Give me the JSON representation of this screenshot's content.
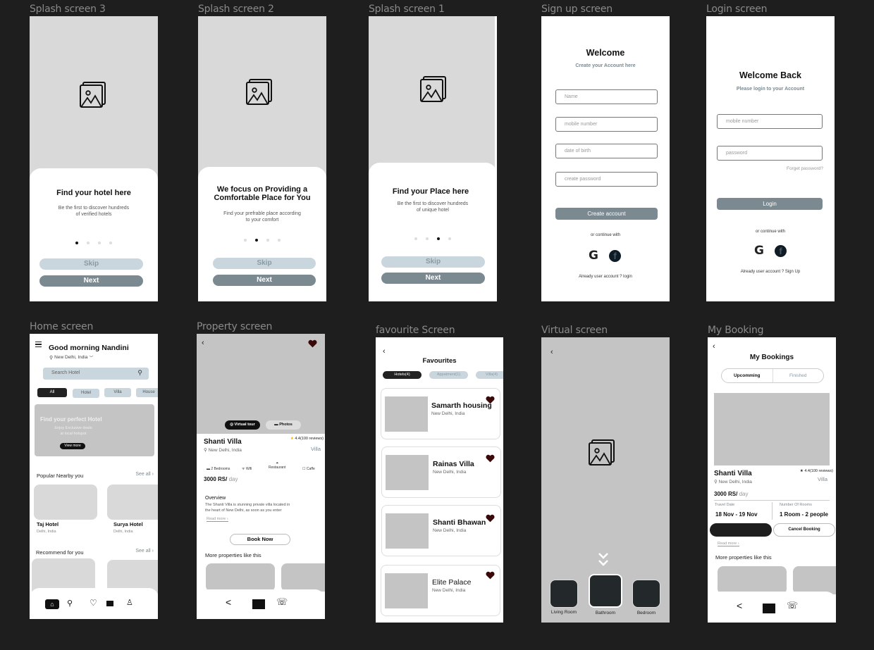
{
  "frames": {
    "splash3": {
      "label": "Splash screen 3",
      "title": "Find your hotel here",
      "subtitle_line1": "Be the first to discover hundreds",
      "subtitle_line2": "of verified hotels",
      "active_dot": 0,
      "skip": "Skip",
      "next": "Next"
    },
    "splash2": {
      "label": "Splash screen 2",
      "title_line1": "We focus on Providing a",
      "title_line2": "Comfortable Place for You",
      "subtitle_line1": "Find your prefrable place  according",
      "subtitle_line2": "to your comfort",
      "active_dot": 1,
      "skip": "Skip",
      "next": "Next"
    },
    "splash1": {
      "label": "Splash screen 1",
      "title": "Find your Place here",
      "subtitle_line1": "Be the first to discover hundreds",
      "subtitle_line2": "of unique hotel",
      "active_dot": 2,
      "skip": "Skip",
      "next": "Next"
    },
    "signup": {
      "label": "Sign up screen",
      "title": "Welcome",
      "subtitle": "Create your Account here",
      "fields": [
        "Name",
        "mobile number",
        "date of birth",
        "create password"
      ],
      "submit": "Create account",
      "or_continue": "or continue with",
      "footer": "Already user account ? login"
    },
    "login": {
      "label": "Login screen",
      "title": "Welcome Back",
      "subtitle": "Please login to your Account",
      "fields": [
        "mobile number",
        "password"
      ],
      "forgot": "Forget password?",
      "submit": "Login",
      "or_continue": "or continue with",
      "footer": "Already user account ? Sign Up"
    },
    "home": {
      "label": "Home screen",
      "greeting": "Good morning Nandini",
      "location": "New Delhi, India",
      "search_placeholder": "Search Hotel",
      "chips": [
        "All",
        "Hotel",
        "Villa",
        "House"
      ],
      "banner_title": "Find your perfect Hotel",
      "banner_sub1": "Enjoy Exclusive deals",
      "banner_sub2": "at local hotspot",
      "banner_btn": "View more",
      "popular_title": "Popular Nearby you",
      "see_all": "See all",
      "hotels": [
        {
          "name": "Taj Hotel",
          "loc": "Delhi, India"
        },
        {
          "name": "Surya Hotel",
          "loc": "Delhi, India"
        }
      ],
      "recommend_title": "Recommend for you",
      "see_all_2": "See all"
    },
    "property": {
      "label": "Property screen",
      "virtual_tour": "Virtual tour",
      "photos": "Photos",
      "name": "Shanti Villa",
      "location": "New Delhi, India",
      "rating": "4.4(100 reviews)",
      "type": "Villa",
      "amenities": [
        "2 Bedrooms",
        "Wifi",
        "Restaurant",
        "Caffe"
      ],
      "price": "3000 RS/",
      "price_unit": "day",
      "overview_title": "Overview",
      "overview_line1": "The Shanti Villa is stunning private villa located in",
      "overview_line2": "the heart of New Delhi, as soon as you enter",
      "read_more": "Read more",
      "book_now": "Book Now",
      "more_title": "More properties like this"
    },
    "favourite": {
      "label": "favourite Screen",
      "title": "Favourites",
      "tabs": [
        "Hotels(4)",
        "Appatment(1)",
        "Villa(4)"
      ],
      "items": [
        {
          "name": "Samarth housing",
          "loc": "New Delhi, India"
        },
        {
          "name": "Rainas Villa",
          "loc": "New Delhi, India"
        },
        {
          "name": "Shanti Bhawan",
          "loc": "New Delhi, India"
        },
        {
          "name": "Elite Palace",
          "loc": "New Delhi, India"
        }
      ]
    },
    "virtual": {
      "label": "Virtual screen",
      "rooms": [
        "Living Room",
        "Bathroom",
        "Bedroom"
      ],
      "selected_room": "Bathroom"
    },
    "booking": {
      "label": "My Booking",
      "title": "My Bookings",
      "tabs": [
        "Upcomming",
        "Finished"
      ],
      "name": "Shanti Villa",
      "location": "New Delhi, India",
      "rating": "4.4(100 reviews)",
      "type": "Villa",
      "price": "3000 RS/",
      "price_unit": "day",
      "travel_date_label": "Travel Date",
      "travel_date": "18 Nov - 19 Nov",
      "rooms_label": "Number Of Rooms",
      "rooms": "1 Room - 2 people",
      "cancel": "Cancel Booking",
      "read_more": "Read more",
      "more_title": "More properties like this"
    }
  },
  "colors": {
    "canvas": "#1e1e1e",
    "primary_button": "#7b8a91",
    "secondary_button": "#c9d6de",
    "heart": "#3a0a0a",
    "placeholder_grey": "#d9d9d9"
  }
}
